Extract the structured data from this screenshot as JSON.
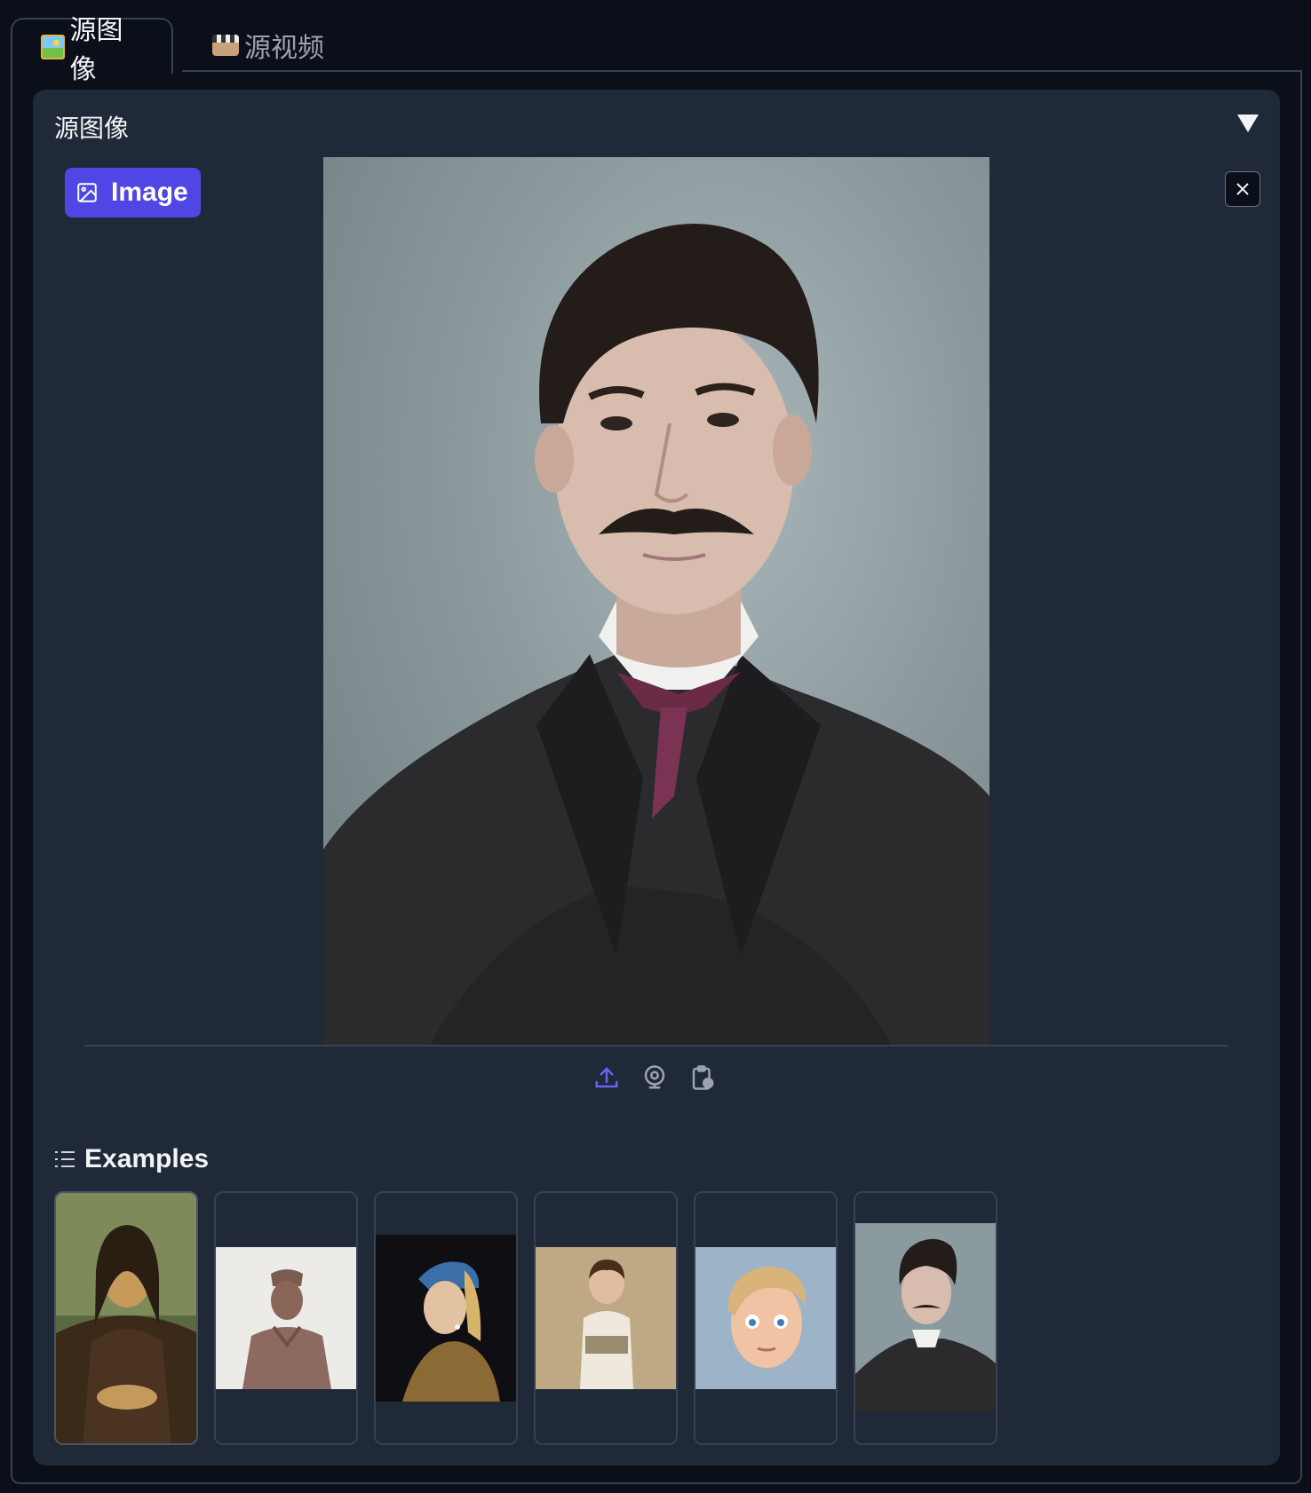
{
  "tabs": [
    {
      "label": "源图像",
      "icon": "framed-picture-icon",
      "active": true
    },
    {
      "label": "源视频",
      "icon": "film-frames-icon",
      "active": false
    }
  ],
  "panel": {
    "title": "源图像",
    "collapse_icon": "triangle-down-icon"
  },
  "image_component": {
    "label": "Image",
    "label_icon": "image-icon",
    "clear_icon": "close-icon",
    "source_buttons": [
      "upload-icon",
      "webcam-icon",
      "clipboard-icon"
    ]
  },
  "examples": {
    "heading": "Examples",
    "icon": "list-icon",
    "items": [
      {
        "name": "example-mona-lisa"
      },
      {
        "name": "example-terracotta-warrior"
      },
      {
        "name": "example-girl-pearl-earring"
      },
      {
        "name": "example-painted-child"
      },
      {
        "name": "example-cartoon-boy"
      },
      {
        "name": "example-portrait-man"
      }
    ]
  },
  "colors": {
    "background": "#0b0f19",
    "panel": "#1f2937",
    "accent": "#4f46e5",
    "border": "#374151"
  }
}
